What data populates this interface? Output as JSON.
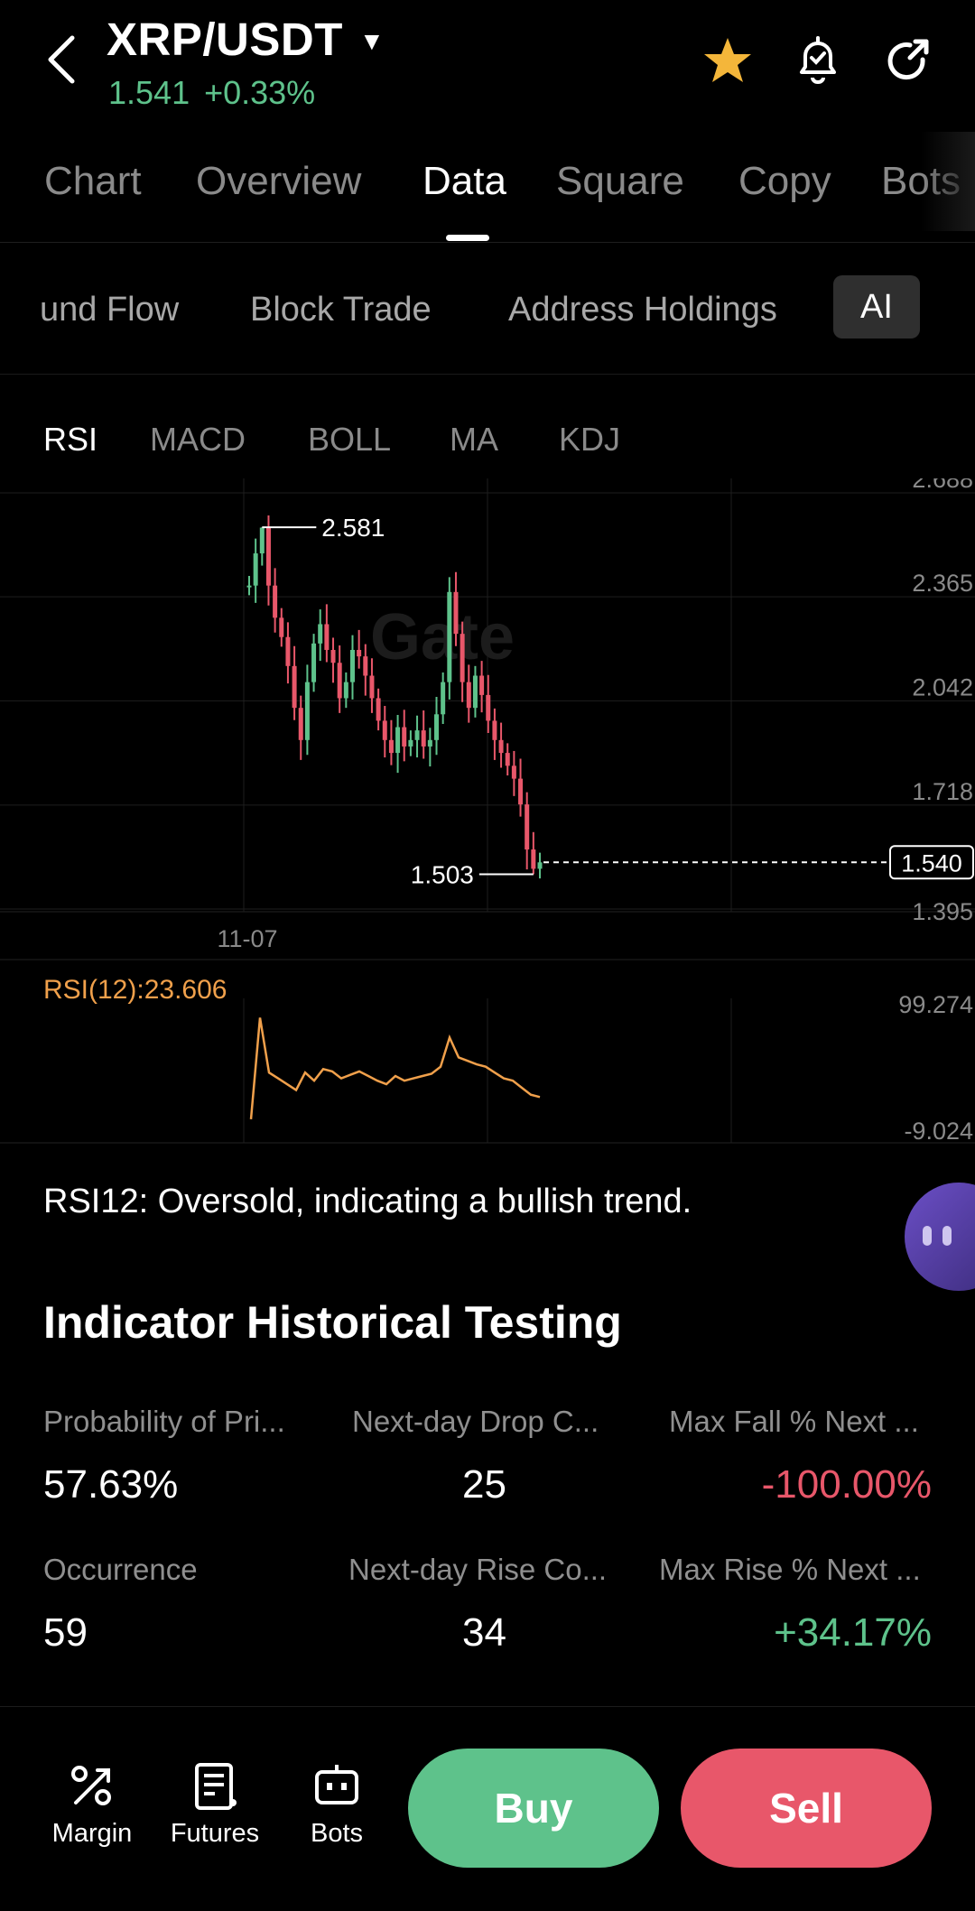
{
  "header": {
    "pair": "XRP/USDT",
    "price": "1.541",
    "change": "+0.33%"
  },
  "tabs": [
    "Chart",
    "Overview",
    "Data",
    "Square",
    "Copy",
    "Bots"
  ],
  "active_tab": "Data",
  "subtabs": [
    "und Flow",
    "Block Trade",
    "Address Holdings",
    "AI"
  ],
  "active_subtab": "AI",
  "indicator_tabs": [
    "RSI",
    "MACD",
    "BOLL",
    "MA",
    "KDJ"
  ],
  "active_indicator": "RSI",
  "watermark": "Gate",
  "chart_data": [
    {
      "type": "candlestick",
      "y_ticks": [
        "2.688",
        "2.365",
        "2.042",
        "1.718",
        "1.395"
      ],
      "x_ticks": [
        "11-07"
      ],
      "ylim": [
        1.395,
        2.688
      ],
      "high_label": "2.581",
      "low_label": "1.503",
      "last_price_label": "1.540",
      "close_path": [
        2.4,
        2.5,
        2.58,
        2.4,
        2.3,
        2.24,
        2.15,
        2.02,
        1.92,
        2.1,
        2.22,
        2.28,
        2.2,
        2.16,
        2.05,
        2.1,
        2.2,
        2.18,
        2.12,
        2.05,
        1.98,
        1.92,
        1.88,
        1.96,
        1.9,
        1.92,
        1.95,
        1.9,
        1.92,
        2.0,
        2.1,
        2.38,
        2.25,
        2.1,
        2.02,
        2.12,
        2.06,
        1.98,
        1.92,
        1.88,
        1.84,
        1.8,
        1.72,
        1.58,
        1.52,
        1.54
      ]
    },
    {
      "type": "line",
      "series": [
        {
          "name": "RSI(12)",
          "values": [
            5,
            92,
            45,
            40,
            35,
            30,
            45,
            38,
            48,
            46,
            40,
            43,
            46,
            42,
            38,
            35,
            42,
            38,
            40,
            42,
            44,
            50,
            75,
            58,
            55,
            52,
            50,
            45,
            40,
            38,
            32,
            26,
            24
          ]
        }
      ],
      "ylim": [
        -9.024,
        99.274
      ],
      "y_ticks": [
        "99.274",
        "-9.024"
      ],
      "series_label": "RSI(12):23.606"
    }
  ],
  "rsi_summary": "RSI12: Oversold, indicating a bullish trend.",
  "history": {
    "title": "Indicator Historical Testing",
    "stats": [
      {
        "label": "Probability of Pri...",
        "value": "57.63%",
        "color": "#ffffff"
      },
      {
        "label": "Next-day Drop C...",
        "value": "25",
        "color": "#ffffff"
      },
      {
        "label": "Max Fall % Next ...",
        "value": "-100.00%",
        "color": "#e8576a"
      },
      {
        "label": "Occurrence",
        "value": "59",
        "color": "#ffffff"
      },
      {
        "label": "Next-day Rise Co...",
        "value": "34",
        "color": "#ffffff"
      },
      {
        "label": "Max Rise % Next ...",
        "value": "+34.17%",
        "color": "#5ec28b"
      }
    ]
  },
  "bottom_nav": [
    {
      "label": "Margin",
      "icon": "margin-icon"
    },
    {
      "label": "Futures",
      "icon": "futures-icon"
    },
    {
      "label": "Bots",
      "icon": "bots-icon"
    }
  ],
  "actions": {
    "buy": "Buy",
    "sell": "Sell"
  },
  "colors": {
    "up": "#5ec28b",
    "down": "#e8576a",
    "star": "#f4b63a",
    "rsi_line": "#f0a04b"
  }
}
